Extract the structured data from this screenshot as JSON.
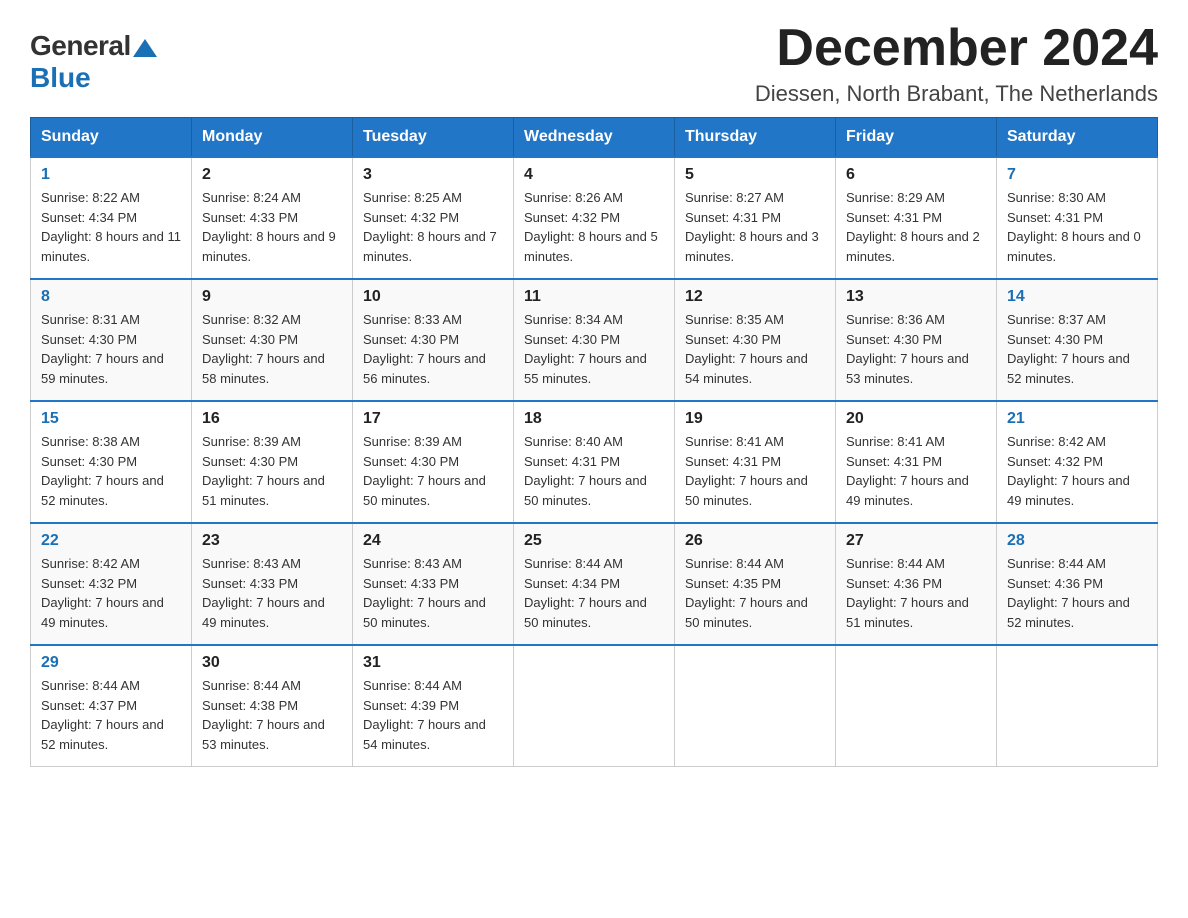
{
  "header": {
    "logo_general": "General",
    "logo_blue": "Blue",
    "month_title": "December 2024",
    "subtitle": "Diessen, North Brabant, The Netherlands"
  },
  "days_of_week": [
    "Sunday",
    "Monday",
    "Tuesday",
    "Wednesday",
    "Thursday",
    "Friday",
    "Saturday"
  ],
  "weeks": [
    [
      {
        "day": "1",
        "sunrise": "8:22 AM",
        "sunset": "4:34 PM",
        "daylight": "8 hours and 11 minutes."
      },
      {
        "day": "2",
        "sunrise": "8:24 AM",
        "sunset": "4:33 PM",
        "daylight": "8 hours and 9 minutes."
      },
      {
        "day": "3",
        "sunrise": "8:25 AM",
        "sunset": "4:32 PM",
        "daylight": "8 hours and 7 minutes."
      },
      {
        "day": "4",
        "sunrise": "8:26 AM",
        "sunset": "4:32 PM",
        "daylight": "8 hours and 5 minutes."
      },
      {
        "day": "5",
        "sunrise": "8:27 AM",
        "sunset": "4:31 PM",
        "daylight": "8 hours and 3 minutes."
      },
      {
        "day": "6",
        "sunrise": "8:29 AM",
        "sunset": "4:31 PM",
        "daylight": "8 hours and 2 minutes."
      },
      {
        "day": "7",
        "sunrise": "8:30 AM",
        "sunset": "4:31 PM",
        "daylight": "8 hours and 0 minutes."
      }
    ],
    [
      {
        "day": "8",
        "sunrise": "8:31 AM",
        "sunset": "4:30 PM",
        "daylight": "7 hours and 59 minutes."
      },
      {
        "day": "9",
        "sunrise": "8:32 AM",
        "sunset": "4:30 PM",
        "daylight": "7 hours and 58 minutes."
      },
      {
        "day": "10",
        "sunrise": "8:33 AM",
        "sunset": "4:30 PM",
        "daylight": "7 hours and 56 minutes."
      },
      {
        "day": "11",
        "sunrise": "8:34 AM",
        "sunset": "4:30 PM",
        "daylight": "7 hours and 55 minutes."
      },
      {
        "day": "12",
        "sunrise": "8:35 AM",
        "sunset": "4:30 PM",
        "daylight": "7 hours and 54 minutes."
      },
      {
        "day": "13",
        "sunrise": "8:36 AM",
        "sunset": "4:30 PM",
        "daylight": "7 hours and 53 minutes."
      },
      {
        "day": "14",
        "sunrise": "8:37 AM",
        "sunset": "4:30 PM",
        "daylight": "7 hours and 52 minutes."
      }
    ],
    [
      {
        "day": "15",
        "sunrise": "8:38 AM",
        "sunset": "4:30 PM",
        "daylight": "7 hours and 52 minutes."
      },
      {
        "day": "16",
        "sunrise": "8:39 AM",
        "sunset": "4:30 PM",
        "daylight": "7 hours and 51 minutes."
      },
      {
        "day": "17",
        "sunrise": "8:39 AM",
        "sunset": "4:30 PM",
        "daylight": "7 hours and 50 minutes."
      },
      {
        "day": "18",
        "sunrise": "8:40 AM",
        "sunset": "4:31 PM",
        "daylight": "7 hours and 50 minutes."
      },
      {
        "day": "19",
        "sunrise": "8:41 AM",
        "sunset": "4:31 PM",
        "daylight": "7 hours and 50 minutes."
      },
      {
        "day": "20",
        "sunrise": "8:41 AM",
        "sunset": "4:31 PM",
        "daylight": "7 hours and 49 minutes."
      },
      {
        "day": "21",
        "sunrise": "8:42 AM",
        "sunset": "4:32 PM",
        "daylight": "7 hours and 49 minutes."
      }
    ],
    [
      {
        "day": "22",
        "sunrise": "8:42 AM",
        "sunset": "4:32 PM",
        "daylight": "7 hours and 49 minutes."
      },
      {
        "day": "23",
        "sunrise": "8:43 AM",
        "sunset": "4:33 PM",
        "daylight": "7 hours and 49 minutes."
      },
      {
        "day": "24",
        "sunrise": "8:43 AM",
        "sunset": "4:33 PM",
        "daylight": "7 hours and 50 minutes."
      },
      {
        "day": "25",
        "sunrise": "8:44 AM",
        "sunset": "4:34 PM",
        "daylight": "7 hours and 50 minutes."
      },
      {
        "day": "26",
        "sunrise": "8:44 AM",
        "sunset": "4:35 PM",
        "daylight": "7 hours and 50 minutes."
      },
      {
        "day": "27",
        "sunrise": "8:44 AM",
        "sunset": "4:36 PM",
        "daylight": "7 hours and 51 minutes."
      },
      {
        "day": "28",
        "sunrise": "8:44 AM",
        "sunset": "4:36 PM",
        "daylight": "7 hours and 52 minutes."
      }
    ],
    [
      {
        "day": "29",
        "sunrise": "8:44 AM",
        "sunset": "4:37 PM",
        "daylight": "7 hours and 52 minutes."
      },
      {
        "day": "30",
        "sunrise": "8:44 AM",
        "sunset": "4:38 PM",
        "daylight": "7 hours and 53 minutes."
      },
      {
        "day": "31",
        "sunrise": "8:44 AM",
        "sunset": "4:39 PM",
        "daylight": "7 hours and 54 minutes."
      },
      null,
      null,
      null,
      null
    ]
  ]
}
